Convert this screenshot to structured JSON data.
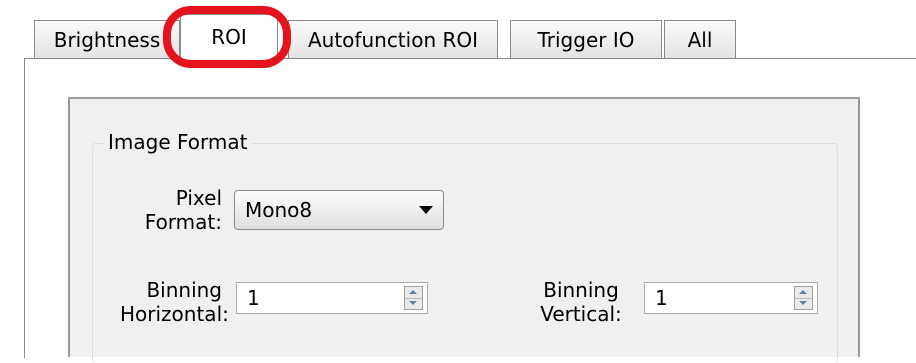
{
  "tabs": [
    {
      "label": "Brightness",
      "active": false
    },
    {
      "label": "ROI",
      "active": true
    },
    {
      "label": "Autofunction ROI",
      "active": false
    },
    {
      "label": "Trigger IO",
      "active": false
    },
    {
      "label": "All",
      "active": false
    }
  ],
  "highlight_color": "#e3141e",
  "image_format": {
    "group_title": "Image Format",
    "pixel_format": {
      "label_line1": "Pixel",
      "label_line2": "Format:",
      "value": "Mono8"
    },
    "binning_horizontal": {
      "label_line1": "Binning",
      "label_line2": "Horizontal:",
      "value": "1"
    },
    "binning_vertical": {
      "label_line1": "Binning",
      "label_line2": "Vertical:",
      "value": "1"
    }
  }
}
